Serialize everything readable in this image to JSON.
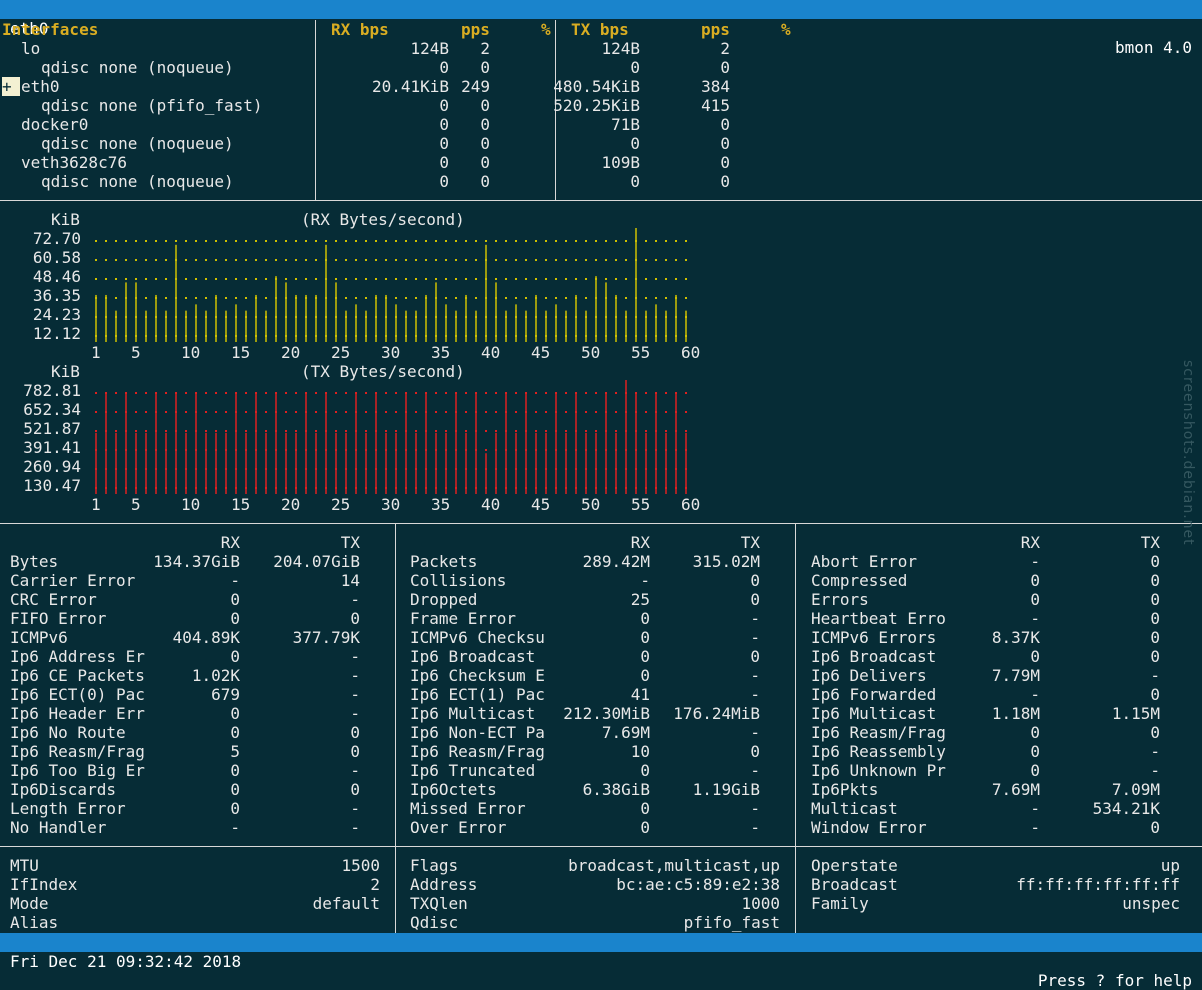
{
  "title_bar": {
    "left": "eth0",
    "right": "bmon 4.0"
  },
  "interfaces_table": {
    "headers": {
      "interfaces": "Interfaces",
      "rx_bps": "RX bps",
      "rx_pps": "pps",
      "rx_pct": "%",
      "tx_bps": "TX bps",
      "tx_pps": "pps",
      "tx_pct": "%"
    },
    "rows": [
      {
        "name": "lo",
        "indent": 1,
        "rx_bps": "124B",
        "rx_pps": "2",
        "tx_bps": "124B",
        "tx_pps": "2"
      },
      {
        "name": "qdisc none (noqueue)",
        "indent": 2,
        "rx_bps": "0",
        "rx_pps": "0",
        "tx_bps": "0",
        "tx_pps": "0"
      },
      {
        "name": "eth0",
        "indent": 1,
        "selected": true,
        "rx_bps": "20.41KiB",
        "rx_pps": "249",
        "tx_bps": "480.54KiB",
        "tx_pps": "384"
      },
      {
        "name": "qdisc none (pfifo_fast)",
        "indent": 2,
        "rx_bps": "0",
        "rx_pps": "0",
        "tx_bps": "520.25KiB",
        "tx_pps": "415"
      },
      {
        "name": "docker0",
        "indent": 1,
        "rx_bps": "0",
        "rx_pps": "0",
        "tx_bps": "71B",
        "tx_pps": "0"
      },
      {
        "name": "qdisc none (noqueue)",
        "indent": 2,
        "rx_bps": "0",
        "rx_pps": "0",
        "tx_bps": "0",
        "tx_pps": "0"
      },
      {
        "name": "veth3628c76",
        "indent": 1,
        "rx_bps": "0",
        "rx_pps": "0",
        "tx_bps": "109B",
        "tx_pps": "0"
      },
      {
        "name": "qdisc none (noqueue)",
        "indent": 2,
        "rx_bps": "0",
        "rx_pps": "0",
        "tx_bps": "0",
        "tx_pps": "0"
      }
    ]
  },
  "chart_data": [
    {
      "type": "bar",
      "title": "(RX Bytes/second)",
      "ylabel": "KiB",
      "y_ticks": [
        "72.70",
        "60.58",
        "48.46",
        "36.35",
        "24.23",
        "12.12"
      ],
      "x_ticks": [
        "1",
        "5",
        "10",
        "15",
        "20",
        "25",
        "30",
        "35",
        "40",
        "45",
        "50",
        "55",
        "60"
      ],
      "ylim": [
        0,
        72.7
      ],
      "color": "#cfc000",
      "categories": [
        1,
        2,
        3,
        4,
        5,
        6,
        7,
        8,
        9,
        10,
        11,
        12,
        13,
        14,
        15,
        16,
        17,
        18,
        19,
        20,
        21,
        22,
        23,
        24,
        25,
        26,
        27,
        28,
        29,
        30,
        31,
        32,
        33,
        34,
        35,
        36,
        37,
        38,
        39,
        40,
        41,
        42,
        43,
        44,
        45,
        46,
        47,
        48,
        49,
        50,
        51,
        52,
        53,
        54,
        55,
        56,
        57,
        58,
        59,
        60
      ],
      "values": [
        30,
        30,
        20,
        38,
        38,
        20,
        30,
        20,
        62,
        20,
        24,
        20,
        30,
        20,
        24,
        20,
        30,
        20,
        42,
        38,
        30,
        30,
        30,
        62,
        38,
        20,
        24,
        20,
        30,
        30,
        24,
        20,
        20,
        30,
        38,
        24,
        20,
        30,
        20,
        62,
        38,
        20,
        24,
        20,
        30,
        20,
        24,
        20,
        30,
        20,
        42,
        38,
        30,
        20,
        75,
        20,
        24,
        20,
        30,
        20
      ]
    },
    {
      "type": "bar",
      "title": "(TX Bytes/second)",
      "ylabel": "KiB",
      "y_ticks": [
        "782.81",
        "652.34",
        "521.87",
        "391.41",
        "260.94",
        "130.47"
      ],
      "x_ticks": [
        "1",
        "5",
        "10",
        "15",
        "20",
        "25",
        "30",
        "35",
        "40",
        "45",
        "50",
        "55",
        "60"
      ],
      "ylim": [
        0,
        782.81
      ],
      "color": "#dd2020",
      "categories": [
        1,
        2,
        3,
        4,
        5,
        6,
        7,
        8,
        9,
        10,
        11,
        12,
        13,
        14,
        15,
        16,
        17,
        18,
        19,
        20,
        21,
        22,
        23,
        24,
        25,
        26,
        27,
        28,
        29,
        30,
        31,
        32,
        33,
        34,
        35,
        36,
        37,
        38,
        39,
        40,
        41,
        42,
        43,
        44,
        45,
        46,
        47,
        48,
        49,
        50,
        51,
        52,
        53,
        54,
        55,
        56,
        57,
        58,
        59,
        60
      ],
      "values": [
        420,
        700,
        420,
        700,
        420,
        420,
        700,
        420,
        700,
        420,
        700,
        420,
        420,
        420,
        700,
        420,
        700,
        420,
        700,
        420,
        420,
        700,
        420,
        700,
        420,
        420,
        700,
        420,
        700,
        420,
        420,
        700,
        420,
        700,
        420,
        420,
        700,
        420,
        700,
        280,
        420,
        700,
        420,
        700,
        420,
        420,
        700,
        420,
        700,
        420,
        420,
        700,
        420,
        800,
        700,
        420,
        700,
        420,
        700,
        420
      ]
    }
  ],
  "stats": {
    "col1": {
      "rx_header": "RX",
      "tx_header": "TX",
      "rows": [
        [
          "Bytes",
          "134.37GiB",
          "204.07GiB"
        ],
        [
          "Carrier Error",
          "-",
          "14"
        ],
        [
          "CRC Error",
          "0",
          "-"
        ],
        [
          "FIFO Error",
          "0",
          "0"
        ],
        [
          "ICMPv6",
          "404.89K",
          "377.79K"
        ],
        [
          "Ip6 Address Er",
          "0",
          "-"
        ],
        [
          "Ip6 CE Packets",
          "1.02K",
          "-"
        ],
        [
          "Ip6 ECT(0) Pac",
          "679",
          "-"
        ],
        [
          "Ip6 Header Err",
          "0",
          "-"
        ],
        [
          "Ip6 No Route",
          "0",
          "0"
        ],
        [
          "Ip6 Reasm/Frag",
          "5",
          "0"
        ],
        [
          "Ip6 Too Big Er",
          "0",
          "-"
        ],
        [
          "Ip6Discards",
          "0",
          "0"
        ],
        [
          "Length Error",
          "0",
          "-"
        ],
        [
          "No Handler",
          "-",
          "-"
        ]
      ]
    },
    "col2": {
      "rx_header": "RX",
      "tx_header": "TX",
      "rows": [
        [
          "Packets",
          "289.42M",
          "315.02M"
        ],
        [
          "Collisions",
          "-",
          "0"
        ],
        [
          "Dropped",
          "25",
          "0"
        ],
        [
          "Frame Error",
          "0",
          "-"
        ],
        [
          "ICMPv6 Checksu",
          "0",
          "-"
        ],
        [
          "Ip6 Broadcast",
          "0",
          "0"
        ],
        [
          "Ip6 Checksum E",
          "0",
          "-"
        ],
        [
          "Ip6 ECT(1) Pac",
          "41",
          "-"
        ],
        [
          "Ip6 Multicast",
          "212.30MiB",
          "176.24MiB"
        ],
        [
          "Ip6 Non-ECT Pa",
          "7.69M",
          "-"
        ],
        [
          "Ip6 Reasm/Frag",
          "10",
          "0"
        ],
        [
          "Ip6 Truncated",
          "0",
          "-"
        ],
        [
          "Ip6Octets",
          "6.38GiB",
          "1.19GiB"
        ],
        [
          "Missed Error",
          "0",
          "-"
        ],
        [
          "Over Error",
          "0",
          "-"
        ]
      ]
    },
    "col3": {
      "rx_header": "RX",
      "tx_header": "TX",
      "rows": [
        [
          "Abort Error",
          "-",
          "0"
        ],
        [
          "Compressed",
          "0",
          "0"
        ],
        [
          "Errors",
          "0",
          "0"
        ],
        [
          "Heartbeat Erro",
          "-",
          "0"
        ],
        [
          "ICMPv6 Errors",
          "8.37K",
          "0"
        ],
        [
          "Ip6 Broadcast",
          "0",
          "0"
        ],
        [
          "Ip6 Delivers",
          "7.79M",
          "-"
        ],
        [
          "Ip6 Forwarded",
          "-",
          "0"
        ],
        [
          "Ip6 Multicast",
          "1.18M",
          "1.15M"
        ],
        [
          "Ip6 Reasm/Frag",
          "0",
          "0"
        ],
        [
          "Ip6 Reassembly",
          "0",
          "-"
        ],
        [
          "Ip6 Unknown Pr",
          "0",
          "-"
        ],
        [
          "Ip6Pkts",
          "7.69M",
          "7.09M"
        ],
        [
          "Multicast",
          "-",
          "534.21K"
        ],
        [
          "Window Error",
          "-",
          "0"
        ]
      ]
    }
  },
  "info": {
    "col1": [
      [
        "MTU",
        "1500"
      ],
      [
        "IfIndex",
        "2"
      ],
      [
        "Mode",
        "default"
      ],
      [
        "Alias",
        ""
      ]
    ],
    "col2": [
      [
        "Flags",
        "broadcast,multicast,up"
      ],
      [
        "Address",
        "bc:ae:c5:89:e2:38"
      ],
      [
        "TXQlen",
        "1000"
      ],
      [
        "Qdisc",
        "pfifo_fast"
      ]
    ],
    "col3": [
      [
        "Operstate",
        "up"
      ],
      [
        "Broadcast",
        "ff:ff:ff:ff:ff:ff"
      ],
      [
        "Family",
        "unspec"
      ]
    ]
  },
  "status_bar": {
    "left": "Fri Dec 21 09:32:42 2018",
    "right": "Press ? for help"
  },
  "watermark": "screenshots.debian.net"
}
